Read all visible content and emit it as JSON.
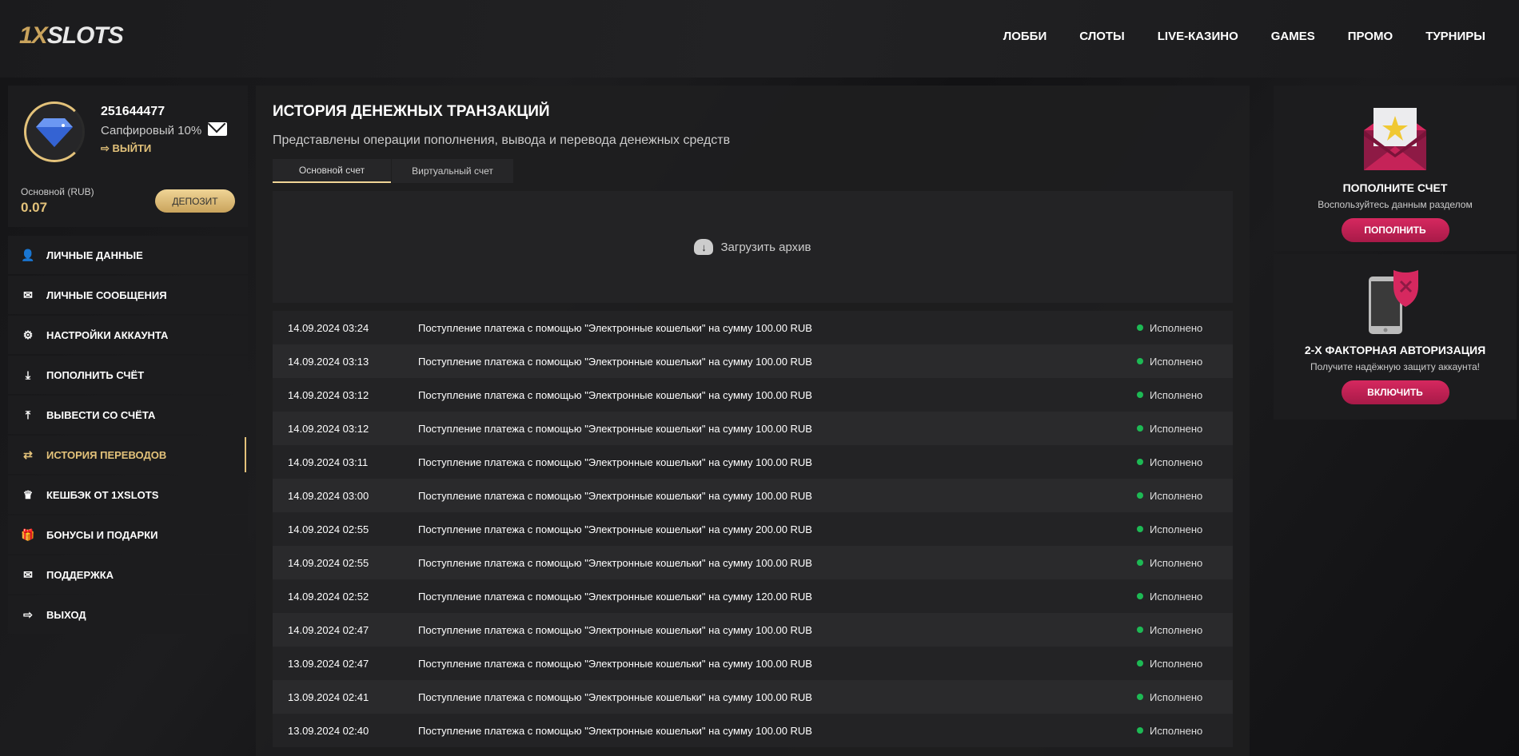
{
  "header": {
    "logo": "1XSLOTS",
    "logo_prefix": "1X",
    "logo_suffix": "SLOTS",
    "nav": [
      "ЛОББИ",
      "СЛОТЫ",
      "LIVE-КАЗИНО",
      "GAMES",
      "ПРОМО",
      "ТУРНИРЫ"
    ]
  },
  "profile": {
    "user_id": "251644477",
    "level": "Сапфировый 10%",
    "logout": "ВЫЙТИ",
    "balance_label": "Основной (RUB)",
    "balance": "0.07",
    "deposit": "ДЕПОЗИТ"
  },
  "menu": [
    {
      "label": "ЛИЧНЫЕ ДАННЫЕ",
      "icon": "user-plus-icon"
    },
    {
      "label": "ЛИЧНЫЕ СООБЩЕНИЯ",
      "icon": "envelope-icon"
    },
    {
      "label": "НАСТРОЙКИ АККАУНТА",
      "icon": "gears-icon"
    },
    {
      "label": "ПОПОЛНИТЬ СЧЁТ",
      "icon": "download-icon"
    },
    {
      "label": "ВЫВЕСТИ СО СЧЁТА",
      "icon": "upload-icon"
    },
    {
      "label": "ИСТОРИЯ ПЕРЕВОДОВ",
      "icon": "transfer-arrows-icon",
      "active": true
    },
    {
      "label": "КЕШБЭК ОТ 1XSLOTS",
      "icon": "crown-icon"
    },
    {
      "label": "БОНУСЫ И ПОДАРКИ",
      "icon": "gift-icon"
    },
    {
      "label": "ПОДДЕРЖКА",
      "icon": "envelope-icon"
    },
    {
      "label": "ВЫХОД",
      "icon": "logout-icon"
    }
  ],
  "main": {
    "title": "ИСТОРИЯ ДЕНЕЖНЫХ ТРАНЗАКЦИЙ",
    "subtitle": "Представлены операции пополнения, вывода и перевода денежных средств",
    "tabs": [
      "Основной счет",
      "Виртуальный счет"
    ],
    "upload": "Загрузить архив",
    "transactions": [
      {
        "date": "14.09.2024 03:24",
        "text": "Поступление платежа с помощью \"Электронные кошельки\" на сумму 100.00 RUB",
        "status": "Исполнено"
      },
      {
        "date": "14.09.2024 03:13",
        "text": "Поступление платежа с помощью \"Электронные кошельки\" на сумму 100.00 RUB",
        "status": "Исполнено"
      },
      {
        "date": "14.09.2024 03:12",
        "text": "Поступление платежа с помощью \"Электронные кошельки\" на сумму 100.00 RUB",
        "status": "Исполнено"
      },
      {
        "date": "14.09.2024 03:12",
        "text": "Поступление платежа с помощью \"Электронные кошельки\" на сумму 100.00 RUB",
        "status": "Исполнено"
      },
      {
        "date": "14.09.2024 03:11",
        "text": "Поступление платежа с помощью \"Электронные кошельки\" на сумму 100.00 RUB",
        "status": "Исполнено"
      },
      {
        "date": "14.09.2024 03:00",
        "text": "Поступление платежа с помощью \"Электронные кошельки\" на сумму 100.00 RUB",
        "status": "Исполнено"
      },
      {
        "date": "14.09.2024 02:55",
        "text": "Поступление платежа с помощью \"Электронные кошельки\" на сумму 200.00 RUB",
        "status": "Исполнено"
      },
      {
        "date": "14.09.2024 02:55",
        "text": "Поступление платежа с помощью \"Электронные кошельки\" на сумму 100.00 RUB",
        "status": "Исполнено"
      },
      {
        "date": "14.09.2024 02:52",
        "text": "Поступление платежа с помощью \"Электронные кошельки\" на сумму 120.00 RUB",
        "status": "Исполнено"
      },
      {
        "date": "14.09.2024 02:47",
        "text": "Поступление платежа с помощью \"Электронные кошельки\" на сумму 100.00 RUB",
        "status": "Исполнено"
      },
      {
        "date": "13.09.2024 02:47",
        "text": "Поступление платежа с помощью \"Электронные кошельки\" на сумму 100.00 RUB",
        "status": "Исполнено"
      },
      {
        "date": "13.09.2024 02:41",
        "text": "Поступление платежа с помощью \"Электронные кошельки\" на сумму 100.00 RUB",
        "status": "Исполнено"
      },
      {
        "date": "13.09.2024 02:40",
        "text": "Поступление платежа с помощью \"Электронные кошельки\" на сумму 100.00 RUB",
        "status": "Исполнено"
      }
    ]
  },
  "promo": [
    {
      "title": "ПОПОЛНИТЕ СЧЕТ",
      "text": "Воспользуйтесь данным разделом",
      "button": "ПОПОЛНИТЬ"
    },
    {
      "title": "2-Х ФАКТОРНАЯ АВТОРИЗАЦИЯ",
      "text": "Получите надёжную защиту аккаунта!",
      "button": "ВКЛЮЧИТЬ"
    }
  ],
  "colors": {
    "accent_gold": "#e3c27a",
    "promo_pink": "#d6285f",
    "status_green": "#1db954"
  }
}
